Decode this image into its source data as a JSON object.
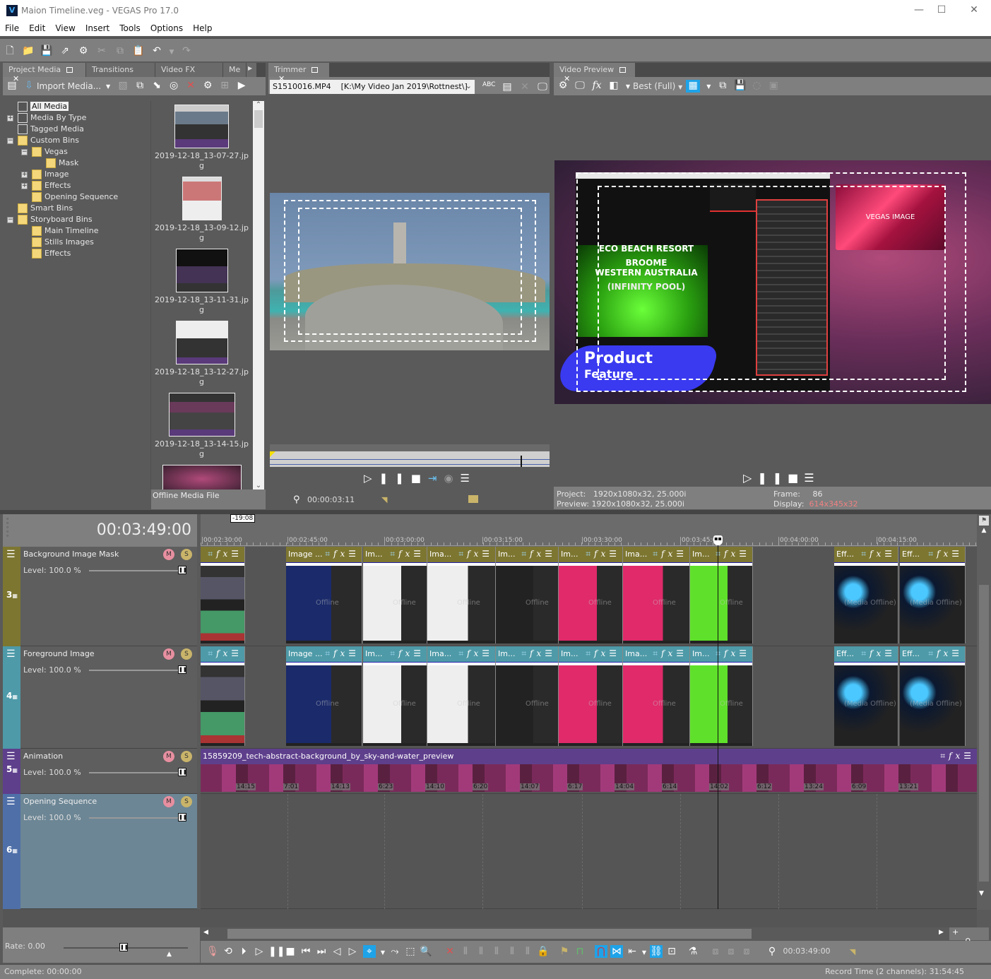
{
  "window": {
    "title": "Maion Timeline.veg - VEGAS Pro 17.0",
    "logo": "V",
    "controls": {
      "minimize": "—",
      "maximize": "☐",
      "close": "✕"
    }
  },
  "menu": [
    "File",
    "Edit",
    "View",
    "Insert",
    "Tools",
    "Options",
    "Help"
  ],
  "main_toolbar": [
    {
      "name": "new-icon",
      "glyph": "🗋"
    },
    {
      "name": "open-icon",
      "glyph": "📁"
    },
    {
      "name": "save-icon",
      "glyph": "💾"
    },
    {
      "name": "render-as-icon",
      "glyph": "⇗"
    },
    {
      "name": "properties-icon",
      "glyph": "⚙"
    },
    {
      "name": "cut-icon",
      "glyph": "✂"
    },
    {
      "name": "copy-icon",
      "glyph": "⧉"
    },
    {
      "name": "paste-icon",
      "glyph": "📋"
    },
    {
      "name": "undo-icon",
      "glyph": "↶"
    },
    {
      "name": "redo-icon",
      "glyph": "↷"
    }
  ],
  "project_media": {
    "tabs": [
      "Project Media",
      "Transitions",
      "Video FX",
      "Me"
    ],
    "import_label": "Import Media...",
    "tree": [
      {
        "label": "All Media",
        "level": 0,
        "selected": true,
        "expander": "",
        "icon": "media"
      },
      {
        "label": "Media By Type",
        "level": 0,
        "expander": "+",
        "icon": "media"
      },
      {
        "label": "Tagged Media",
        "level": 0,
        "expander": "",
        "icon": "media"
      },
      {
        "label": "Custom Bins",
        "level": 0,
        "expander": "−",
        "icon": "folder"
      },
      {
        "label": "Vegas",
        "level": 1,
        "expander": "−",
        "icon": "folder"
      },
      {
        "label": "Mask",
        "level": 2,
        "expander": "",
        "icon": "folder"
      },
      {
        "label": "Image",
        "level": 1,
        "expander": "+",
        "icon": "folder"
      },
      {
        "label": "Effects",
        "level": 1,
        "expander": "+",
        "icon": "folder"
      },
      {
        "label": "Opening Sequence",
        "level": 1,
        "expander": "",
        "icon": "folder"
      },
      {
        "label": "Smart Bins",
        "level": 0,
        "expander": "",
        "icon": "folder"
      },
      {
        "label": "Storyboard Bins",
        "level": 0,
        "expander": "−",
        "icon": "folder"
      },
      {
        "label": "Main Timeline",
        "level": 1,
        "expander": "",
        "icon": "folder"
      },
      {
        "label": "Stills Images",
        "level": 1,
        "expander": "",
        "icon": "folder"
      },
      {
        "label": "Effects",
        "level": 1,
        "expander": "",
        "icon": "folder"
      }
    ],
    "thumbnails": [
      {
        "line1": "2019-12-18_13-07-27.jp",
        "line2": "g"
      },
      {
        "line1": "2019-12-18_13-09-12.jp",
        "line2": "g"
      },
      {
        "line1": "2019-12-18_13-11-31.jp",
        "line2": "g"
      },
      {
        "line1": "2019-12-18_13-12-27.jp",
        "line2": "g"
      },
      {
        "line1": "2019-12-18_13-14-15.jp",
        "line2": "g"
      }
    ],
    "status": "Offline Media File"
  },
  "trimmer": {
    "tab": "Trimmer",
    "file": "S1510016.MP4    [K:\\My Video Jan 2019\\Rottnest\\]",
    "timecode": "00:00:03:11"
  },
  "video_preview": {
    "tab": "Video Preview",
    "quality": "Best (Full)",
    "project_label": "Project:",
    "project_value": "1920x1080x32, 25.000i",
    "preview_label": "Preview:",
    "preview_value": "1920x1080x32, 25.000i",
    "frame_label": "Frame:",
    "frame_value": "86",
    "display_label": "Display:",
    "display_value": "614x345x32",
    "display_color": "#f08080",
    "overlay": {
      "line1": "ECO BEACH RESORT",
      "line2": "BROOME",
      "line3": "WESTERN AUSTRALIA",
      "line4": "(INFINITY POOL)",
      "product": "Product",
      "feature": "Feature",
      "vegas_image": "VEGAS IMAGE"
    }
  },
  "timeline": {
    "cursor_time": "00:03:49:00",
    "marker_tag": "-19:08",
    "ruler": [
      "00:02:30:00",
      "00:02:45:00",
      "00:03:00:00",
      "00:03:15:00",
      "00:03:30:00",
      "00:03:45:00",
      "00:04:00:00",
      "00:04:15:00"
    ],
    "tracks": [
      {
        "number": "3",
        "name": "Background Image Mask",
        "level": "Level: 100.0 %",
        "color": "#7d7631",
        "clip_color": "#7d7631",
        "clips": [
          "",
          "Image ...",
          "Im...",
          "Ima...",
          "Im...",
          "Im...",
          "Ima...",
          "Im...",
          "Eff...",
          "Eff..."
        ]
      },
      {
        "number": "4",
        "name": "Foreground Image",
        "level": "Level: 100.0 %",
        "color": "#4e9aa8",
        "clip_color": "#4e9aa8",
        "clips": [
          "",
          "Image ...",
          "Im...",
          "Ima...",
          "Im...",
          "Im...",
          "Ima...",
          "Im...",
          "Eff...",
          "Eff..."
        ]
      },
      {
        "number": "5",
        "name": "Animation",
        "level": "Level: 100.0 %",
        "color": "#5e3f8c",
        "clip_color": "#5e3f8c",
        "clip_title": "15859209_tech-abstract-background_by_sky-and-water_preview",
        "frames": [
          "14:15",
          "7:01",
          "14:13",
          "6:23",
          "14:10",
          "6:20",
          "14:07",
          "6:17",
          "14:04",
          "6:14",
          "14:02",
          "6:12",
          "13:24",
          "6:09",
          "13:21"
        ]
      },
      {
        "number": "6",
        "name": "Opening Sequence",
        "level": "Level: 100.0 %",
        "color": "#4f6fa8",
        "clip_color": "#6a8795"
      }
    ],
    "media_offline": "(Media Offline)",
    "offline": "Offline"
  },
  "transport": {
    "rate": "Rate: 0.00",
    "timecode": "00:03:49:00"
  },
  "statusbar": {
    "left": "Complete: 00:00:00",
    "right": "Record Time (2 channels): 31:54:45"
  }
}
